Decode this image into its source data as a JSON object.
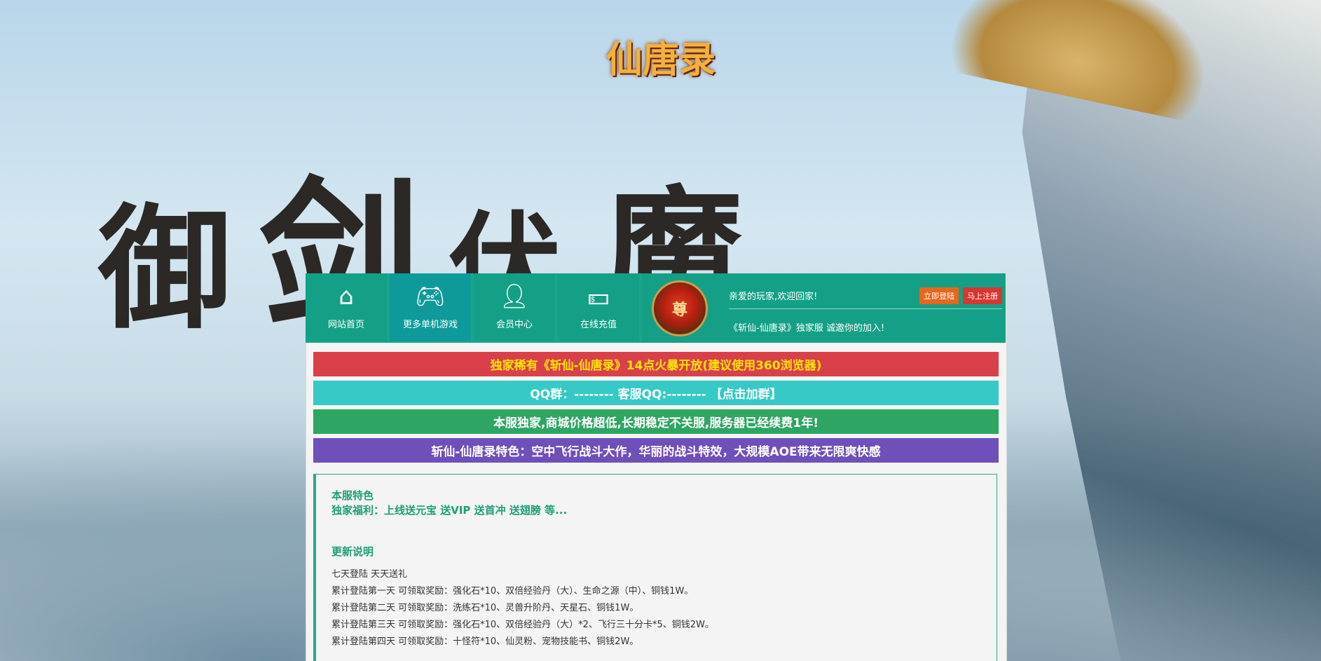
{
  "header": {
    "logo_text": "仙唐录"
  },
  "background": {
    "brush_chars": [
      "御",
      "剑",
      "伏",
      "魔"
    ]
  },
  "nav": {
    "items": [
      {
        "label": "网站首页",
        "icon": "home-icon"
      },
      {
        "label": "更多单机游戏",
        "icon": "gamepad-icon"
      },
      {
        "label": "会员中心",
        "icon": "user-icon"
      },
      {
        "label": "在线充值",
        "icon": "money-icon"
      }
    ]
  },
  "member": {
    "badge_text": "尊",
    "welcome": "亲爱的玩家,欢迎回家!",
    "login_label": "立即登陆",
    "register_label": "马上注册",
    "invite": "《斩仙-仙唐录》独家服 诚邀你的加入!"
  },
  "banners": [
    {
      "text": "独家稀有《斩仙-仙唐录》14点火暴开放(建议使用360浏览器)",
      "color": "#d9404a"
    },
    {
      "text": "QQ群：-------- 客服QQ:-------- 【点击加群】",
      "color": "#36c9c6"
    },
    {
      "text": "本服独家,商城价格超低,长期稳定不关服,服务器已经续费1年!",
      "color": "#2fa563"
    },
    {
      "text": "斩仙-仙唐录特色：空中飞行战斗大作，华丽的战斗特效，大规模AOE带来无限爽快感",
      "color": "#6f4fba"
    }
  ],
  "content": {
    "feature_title": "本服特色",
    "feature_text": "独家福利：上线送元宝 送VIP 送首冲 送翅膀 等...",
    "update_title": "更新说明",
    "lines": [
      "七天登陆 天天送礼",
      "累计登陆第一天 可领取奖励：强化石*10、双倍经验丹（大）、生命之源（中）、铜钱1W。",
      "累计登陆第二天 可领取奖励：洗练石*10、灵兽升阶丹、天星石、铜钱1W。",
      "累计登陆第三天 可领取奖励：强化石*10、双倍经验丹（大）*2、飞行三十分卡*5、铜钱2W。",
      "累计登陆第四天 可领取奖励：十怪符*10、仙灵粉、宠物技能书、铜钱2W。"
    ]
  }
}
